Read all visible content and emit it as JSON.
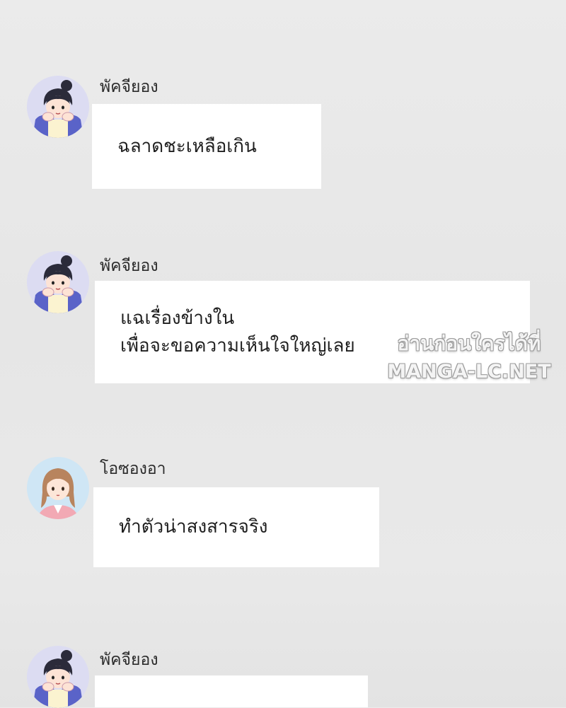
{
  "messages": [
    {
      "sender": "พัคจียอง",
      "avatar_icon": "avatar-park-jiyoung-icon",
      "lines": [
        "ฉลาดชะเหลือเกิน"
      ]
    },
    {
      "sender": "พัคจียอง",
      "avatar_icon": "avatar-park-jiyoung-icon",
      "lines": [
        "แฉเรื่องข้างใน",
        "เพื่อจะขอความเห็นใจใหญ่เลย"
      ]
    },
    {
      "sender": "โอซองอา",
      "avatar_icon": "avatar-oh-seongah-icon",
      "lines": [
        "ทำตัวน่าสงสารจริง"
      ]
    },
    {
      "sender": "พัคจียอง",
      "avatar_icon": "avatar-park-jiyoung-icon",
      "lines": []
    }
  ],
  "watermark": {
    "line1": "อ่านก่อนใครได้ที่",
    "line2": "MANGA-LC.NET"
  },
  "colors": {
    "background": "#e8e8e8",
    "bubble": "#ffffff",
    "text": "#1e1e1e"
  }
}
